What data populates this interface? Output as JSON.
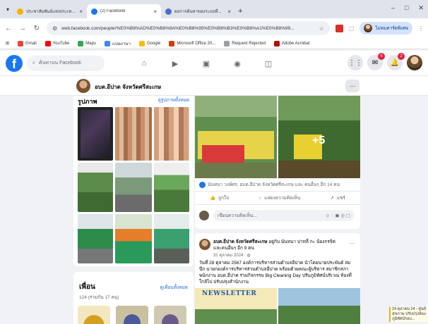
{
  "browser": {
    "tabs": [
      {
        "title": "ประชาสัมพันธ์แห่งประเทศ...",
        "color": "#f2b400",
        "active": false
      },
      {
        "title": "(2) Facebook",
        "color": "#1877f2",
        "active": true
      },
      {
        "title": "ผลการค้นหาของระบบที่...",
        "color": "#4b6fc4",
        "active": false
      }
    ],
    "url": "web.facebook.com/people/%E0%B8%AD%E0%B8%9A%E0%B8%95%E0%B8%B3%E0%B8%A1%E0%B8%99...",
    "profile_label": "ไม่พบคาร์ดพิเศษ",
    "bookmarks": [
      {
        "label": "Gmail",
        "color": "#ea4335"
      },
      {
        "label": "YouTube",
        "color": "#ff0000"
      },
      {
        "label": "Maps",
        "color": "#34a853"
      },
      {
        "label": "แปลภาษา",
        "color": "#4285f4"
      },
      {
        "label": "Google",
        "color": "#fbbc05"
      },
      {
        "label": "Microsoft Office 20...",
        "color": "#d83b01"
      },
      {
        "label": "Request Rejected",
        "color": "#9aa0a6"
      },
      {
        "label": "Adobe Acrobat",
        "color": "#b30b00"
      }
    ]
  },
  "facebook": {
    "search_placeholder": "ค้นหาบน Facebook",
    "notif_badges": [
      "5",
      "2"
    ],
    "page_name": "อบต.อีปาด จังหวัดศรีสะเกษ",
    "photos": {
      "heading": "รูปภาพ",
      "see_all": "ดูรูปภาพทั้งหมด"
    },
    "friends": {
      "heading": "เพื่อน",
      "see_all": "ดูเพื่อนทั้งหมด",
      "count": "124 (ร่วมกัน 17 คน)"
    },
    "post1": {
      "more_photos": "+5",
      "reactions": "นันทนา วงษ์ศร, อบต.อีปาด จังหวัดศรีสะเกษ และ คนอื่นๆ อีก 14 คน",
      "like": "ถูกใจ",
      "comment": "แสดงความคิดเห็น",
      "share": "แชร์",
      "comment_placeholder": "เขียนความคิดเห็น..."
    },
    "post2": {
      "author": "อบต.อีปาด จังหวัดศรีสะเกษ",
      "header_rest": " อยู่กับ นันทนา ปาทลี่ กะ น้องกรจิต และคนอื่นๆ อีก 9 คน",
      "date": "31 ตุลาคม 2024 · ",
      "body": "วันที่ 28 ตุลาคม 2567 องค์การบริหารส่วนตำบลอีปาด นำโดยนายประพันธ์ สมนึก นายกองค์การบริหารส่วนตำบลอีปาด พร้อมด้วยคณะผู้บริหาร สมาชิกสภา พนักงาน อบต.อีปาด ร่วมกิจกรรม Big Cleaning Day ปรับภูมิทัศน์บริเวณ ท้องที่ใกล้ไป ปรับปรุงสำนักงาน",
      "newsletter": "NEWSLETTER"
    },
    "side_note": "24 ตุลาคม 24 - ศูนย์สุขภาพ ปรับปรุงห้อง ภูมิทัศน์รอบ..."
  }
}
